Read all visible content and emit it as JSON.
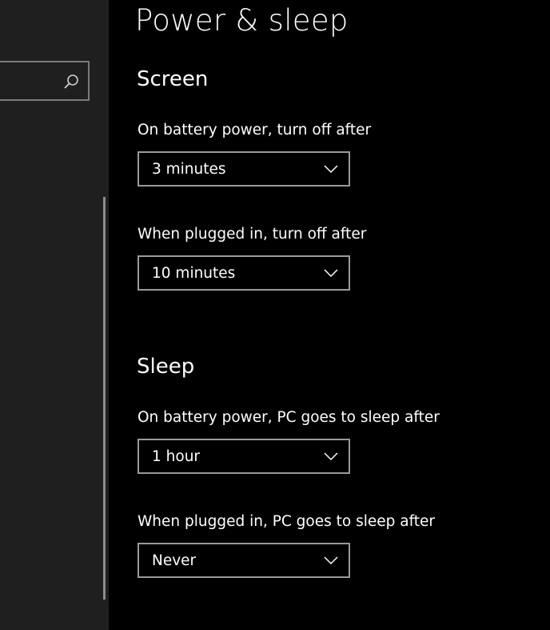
{
  "page": {
    "title": "Power & sleep"
  },
  "sidebar": {
    "search": {
      "value": "",
      "icon": "search-icon"
    }
  },
  "screen": {
    "heading": "Screen",
    "battery": {
      "label": "On battery power, turn off after",
      "value": "3 minutes"
    },
    "plugged": {
      "label": "When plugged in, turn off after",
      "value": "10 minutes"
    }
  },
  "sleep": {
    "heading": "Sleep",
    "battery": {
      "label": "On battery power, PC goes to sleep after",
      "value": "1 hour"
    },
    "plugged": {
      "label": "When plugged in, PC goes to sleep after",
      "value": "Never"
    }
  },
  "colors": {
    "background": "#000000",
    "sidebar": "#1f1f1f",
    "text": "#ffffff",
    "border": "#9a9a9a"
  }
}
